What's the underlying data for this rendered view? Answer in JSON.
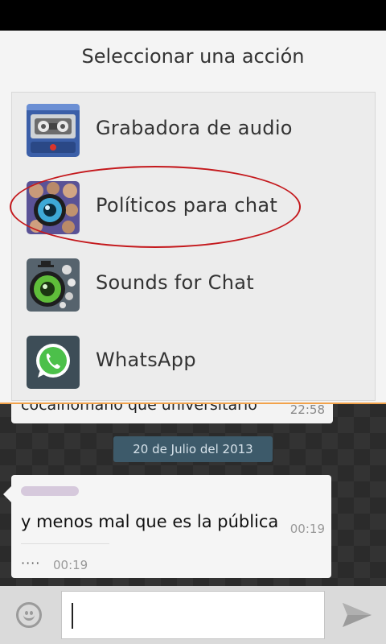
{
  "dialog": {
    "title": "Seleccionar una acción",
    "items": [
      {
        "label": "Grabadora de audio",
        "icon": "cassette-recorder-icon"
      },
      {
        "label": "Políticos para chat",
        "icon": "politicians-speaker-icon"
      },
      {
        "label": "Sounds for Chat",
        "icon": "sounds-speaker-icon"
      },
      {
        "label": "WhatsApp",
        "icon": "whatsapp-icon"
      }
    ]
  },
  "chat": {
    "previous_message": "cocainomano que universitario",
    "previous_time": "22:58",
    "date_label": "20 de Julio del 2013",
    "message_text": "y menos mal que es la pública",
    "message_time": "00:19",
    "quoted_text": "····",
    "quoted_time": "00:19"
  },
  "colors": {
    "accent_border": "#f2a24a",
    "highlight_ellipse": "#c4191d",
    "date_chip": "#3d5a6a"
  }
}
